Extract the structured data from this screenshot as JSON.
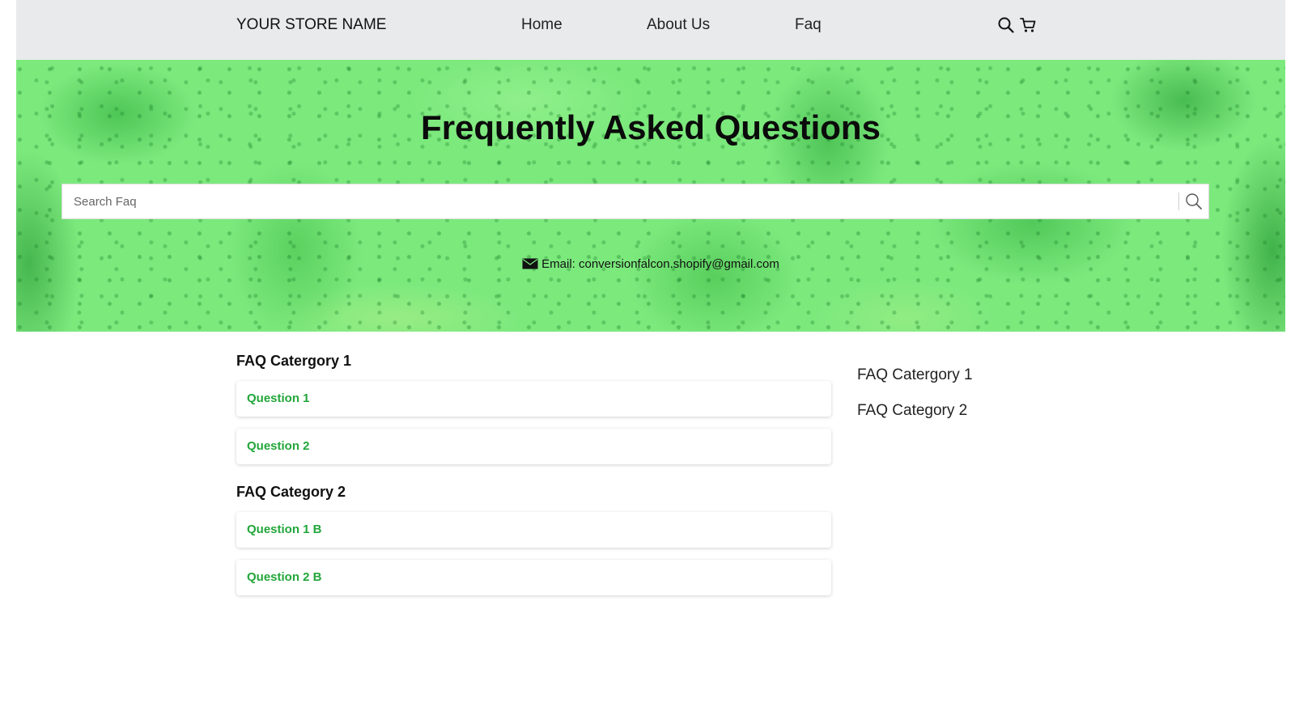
{
  "header": {
    "store_name": "YOUR STORE NAME",
    "nav": [
      {
        "label": "Home"
      },
      {
        "label": "About Us"
      },
      {
        "label": "Faq"
      }
    ],
    "icons": [
      "search-icon",
      "cart-icon"
    ]
  },
  "hero": {
    "title": "Frequently Asked Questions",
    "search": {
      "placeholder": "Search Faq",
      "value": ""
    },
    "email_text": "Email: conversionfalcon.shopify@gmail.com"
  },
  "faq": {
    "categories": [
      {
        "title": "FAQ Catergory 1",
        "questions": [
          "Question 1",
          "Question 2"
        ]
      },
      {
        "title": "FAQ Category 2",
        "questions": [
          "Question 1 B",
          "Question 2 B"
        ]
      }
    ]
  },
  "sidebar": {
    "links": [
      "FAQ Catergory 1",
      "FAQ Category 2"
    ]
  },
  "colors": {
    "header_bg": "#e8eaeb",
    "hero_green": "#7ce97d",
    "question_text": "#22a63a"
  }
}
